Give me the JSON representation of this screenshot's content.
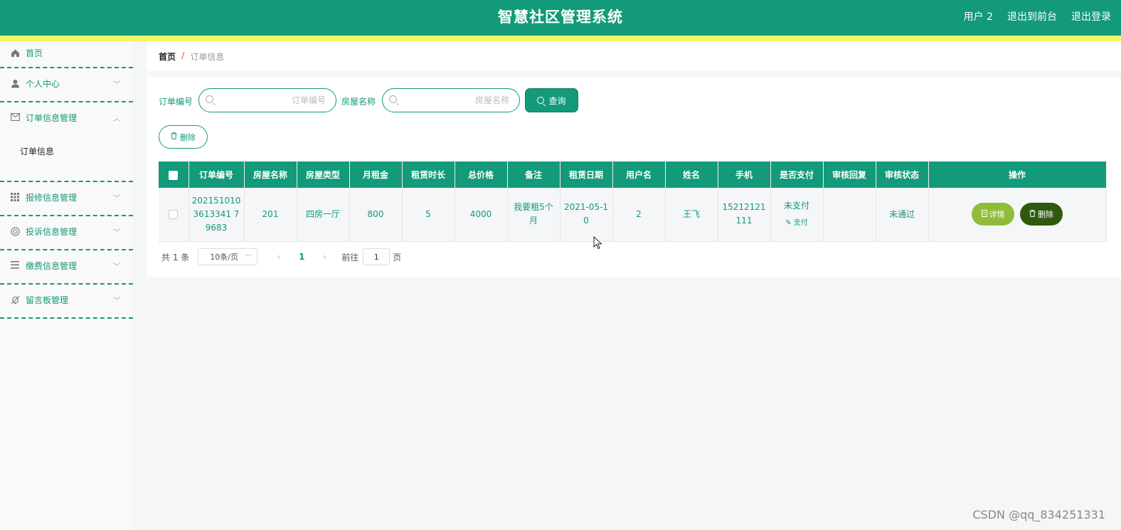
{
  "header": {
    "title": "智慧社区管理系统",
    "user": "用户 2",
    "to_front": "退出到前台",
    "logout": "退出登录"
  },
  "sidebar": {
    "items": [
      {
        "label": "首页",
        "icon": "home-icon"
      },
      {
        "label": "个人中心",
        "icon": "user-icon"
      },
      {
        "label": "订单信息管理",
        "icon": "mail-icon"
      },
      {
        "label": "报修信息管理",
        "icon": "grid-icon"
      },
      {
        "label": "投诉信息管理",
        "icon": "lifebuoy-icon"
      },
      {
        "label": "缴费信息管理",
        "icon": "list-icon"
      },
      {
        "label": "留言板管理",
        "icon": "bell-off-icon"
      }
    ],
    "submenu": {
      "label": "订单信息"
    }
  },
  "breadcrumb": {
    "home": "首页",
    "sep": "/",
    "current": "订单信息"
  },
  "search": {
    "order_label": "订单编号",
    "order_placeholder": "订单编号",
    "house_label": "房屋名称",
    "house_placeholder": "房屋名称",
    "query_label": "查询"
  },
  "actions": {
    "delete_label": "删除"
  },
  "table": {
    "headers": [
      "订单编号",
      "房屋名称",
      "房屋类型",
      "月租金",
      "租赁时长",
      "总价格",
      "备注",
      "租赁日期",
      "用户名",
      "姓名",
      "手机",
      "是否支付",
      "审核回复",
      "审核状态",
      "操作"
    ],
    "rows": [
      {
        "order_no": "2021510103613341 79683",
        "house_name": "201",
        "house_type": "四房一厅",
        "rent": "800",
        "duration": "5",
        "total": "4000",
        "remark": "我要租5个月",
        "date": "2021-05-10",
        "username": "2",
        "name": "王飞",
        "phone": "15212121111",
        "paid": "未支付",
        "pay_link": "支付",
        "reply": "",
        "status": "未通过",
        "detail_btn": "详情",
        "delete_btn": "删除"
      }
    ]
  },
  "pager": {
    "total": "共 1 条",
    "size": "10条/页",
    "page": "1",
    "goto_prefix": "前往",
    "goto_value": "1",
    "goto_suffix": "页"
  },
  "watermark": "CSDN @qq_834251331",
  "colors": {
    "primary": "#129a7a",
    "stripe": "#f4f466",
    "detail": "#8fbd38",
    "danger": "#2e5a0e"
  }
}
